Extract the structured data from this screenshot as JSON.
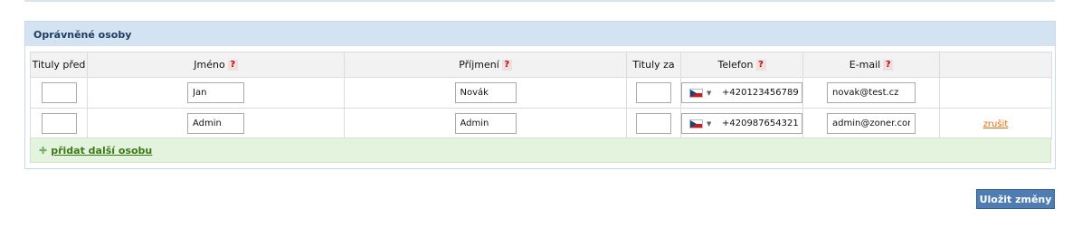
{
  "panel": {
    "title": "Oprávněné osoby"
  },
  "table": {
    "headers": {
      "titles_before": "Tituly před",
      "first_name": "Jméno",
      "last_name": "Příjmení",
      "titles_after": "Tituly za",
      "phone": "Telefon",
      "email": "E-mail"
    },
    "help_glyph": "?",
    "rows": [
      {
        "titles_before": "",
        "first_name": "Jan",
        "last_name": "Novák",
        "titles_after": "",
        "phone_country": "cz-flag-icon",
        "phone": "+420123456789",
        "email": "novak@test.cz",
        "action": ""
      },
      {
        "titles_before": "",
        "first_name": "Admin",
        "last_name": "Admin",
        "titles_after": "",
        "phone_country": "cz-flag-icon",
        "phone": "+420987654321",
        "email": "admin@zoner.com",
        "action": "zrušit"
      }
    ]
  },
  "add_person": {
    "icon": "plus-icon",
    "label": "přidat další osobu"
  },
  "save_button": "Uložit změny",
  "colors": {
    "header_bg": "#d4e3f1",
    "header_text": "#1d3c63",
    "help_red": "#cc0000",
    "add_row_bg": "#e3f3de",
    "add_link": "#3c7a19",
    "cancel_link": "#e36c0a",
    "save_button_bg": "#4f7cb2"
  }
}
